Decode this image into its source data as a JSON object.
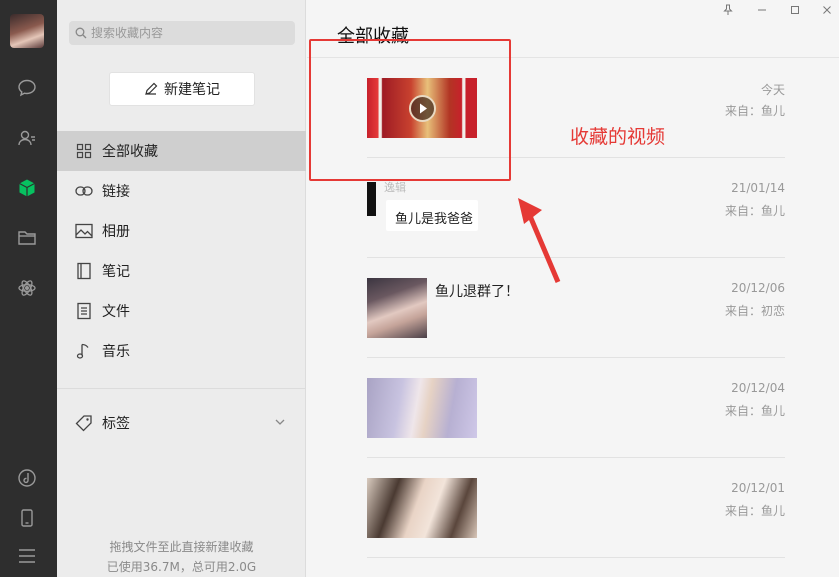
{
  "rail": {
    "icons": [
      "chat-icon",
      "contacts-icon",
      "favorites-cube-icon",
      "folder-icon",
      "miniprogram-icon",
      "music-icon",
      "phone-icon",
      "menu-icon"
    ]
  },
  "search": {
    "placeholder": "搜索收藏内容"
  },
  "new_note_label": "新建笔记",
  "nav": {
    "items": [
      {
        "label": "全部收藏",
        "icon": "grid-icon",
        "active": true
      },
      {
        "label": "链接",
        "icon": "link-icon"
      },
      {
        "label": "相册",
        "icon": "image-icon"
      },
      {
        "label": "笔记",
        "icon": "note-icon"
      },
      {
        "label": "文件",
        "icon": "file-icon"
      },
      {
        "label": "音乐",
        "icon": "music-note-icon"
      }
    ],
    "tags_label": "标签"
  },
  "footer": {
    "line1": "拖拽文件至此直接新建收藏",
    "line2": "已使用36.7M，总可用2.0G"
  },
  "main": {
    "title": "全部收藏",
    "items": [
      {
        "date": "今天",
        "from": "来自：鱼儿",
        "type": "video",
        "caption": ""
      },
      {
        "date": "21/01/14",
        "from": "来自：鱼儿",
        "type": "chat",
        "header": "逸辑",
        "caption": "鱼儿是我爸爸"
      },
      {
        "date": "20/12/06",
        "from": "来自：初恋",
        "type": "image",
        "caption": "鱼儿退群了！"
      },
      {
        "date": "20/12/04",
        "from": "来自：鱼儿",
        "type": "image",
        "caption": ""
      },
      {
        "date": "20/12/01",
        "from": "来自：鱼儿",
        "type": "image",
        "caption": ""
      }
    ]
  },
  "annotation": {
    "label": "收藏的视频",
    "color": "#e53935"
  }
}
